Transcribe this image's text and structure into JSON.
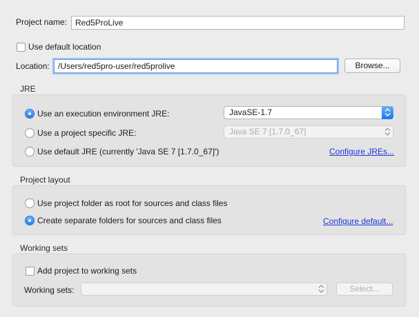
{
  "project": {
    "name_label": "Project name:",
    "name_value": "Red5ProLive",
    "use_default_location_label": "Use default location",
    "use_default_location_checked": false,
    "location_label": "Location:",
    "location_value": "/Users/red5pro-user/red5prolive",
    "browse_label": "Browse..."
  },
  "jre": {
    "title": "JRE",
    "options": [
      {
        "label": "Use an execution environment JRE:",
        "selected": true
      },
      {
        "label": "Use a project specific JRE:",
        "selected": false
      },
      {
        "label": "Use default JRE (currently 'Java SE 7 [1.7.0_67]')",
        "selected": false
      }
    ],
    "execution_env_value": "JavaSE-1.7",
    "project_specific_value": "Java SE 7 [1.7.0_67]",
    "configure_link": "Configure JREs..."
  },
  "layout": {
    "title": "Project layout",
    "options": [
      {
        "label": "Use project folder as root for sources and class files",
        "selected": false
      },
      {
        "label": "Create separate folders for sources and class files",
        "selected": true
      }
    ],
    "configure_link": "Configure default..."
  },
  "working_sets": {
    "title": "Working sets",
    "add_label": "Add project to working sets",
    "add_checked": false,
    "sets_label": "Working sets:",
    "sets_value": "",
    "select_label": "Select..."
  },
  "colors": {
    "accent": "#1e7ef2",
    "link": "#1d35d8",
    "focus_ring": "#9cc1f4"
  }
}
